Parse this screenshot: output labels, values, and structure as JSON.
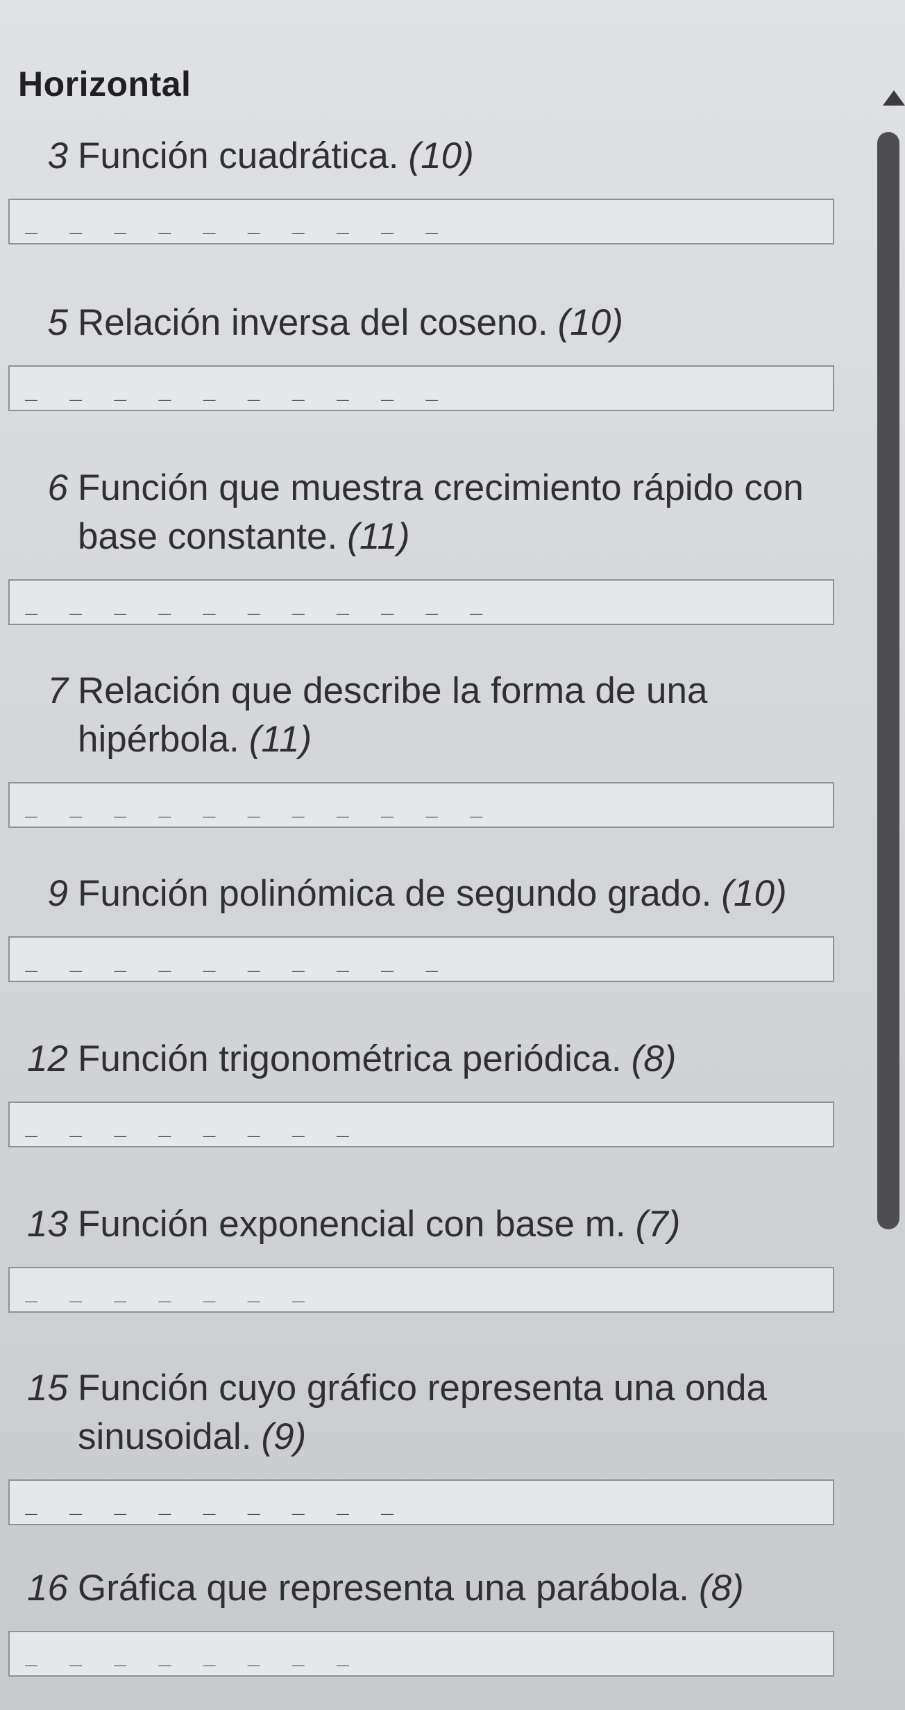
{
  "section": {
    "title": "Horizontal"
  },
  "clues": [
    {
      "number": "3",
      "text": "Función cuadrática.",
      "length": "(10)",
      "slots": "_ _ _ _ _ _ _ _ _ _"
    },
    {
      "number": "5",
      "text": "Relación inversa del coseno.",
      "length": "(10)",
      "slots": "_ _ _ _ _ _ _ _ _ _"
    },
    {
      "number": "6",
      "text": "Función que muestra crecimiento rápido con base constante.",
      "length": "(11)",
      "slots": "_ _ _ _ _ _ _ _ _ _ _"
    },
    {
      "number": "7",
      "text": "Relación que describe la forma de una hipérbola.",
      "length": "(11)",
      "slots": "_ _ _ _ _ _ _ _ _ _ _"
    },
    {
      "number": "9",
      "text": "Función polinómica de segundo grado.",
      "length": "(10)",
      "slots": "_ _ _ _ _ _ _ _ _ _"
    },
    {
      "number": "12",
      "text": "Función trigonométrica periódica.",
      "length": "(8)",
      "slots": "_ _ _ _ _ _ _ _"
    },
    {
      "number": "13",
      "text": "Función exponencial con base m.",
      "length": "(7)",
      "slots": "_ _ _ _ _ _ _"
    },
    {
      "number": "15",
      "text": "Función cuyo gráfico representa una onda sinusoidal.",
      "length": "(9)",
      "slots": "_ _ _ _ _ _ _ _ _"
    },
    {
      "number": "16",
      "text": "Gráfica que representa una parábola.",
      "length": "(8)",
      "slots": "_ _ _ _ _ _ _ _"
    }
  ]
}
